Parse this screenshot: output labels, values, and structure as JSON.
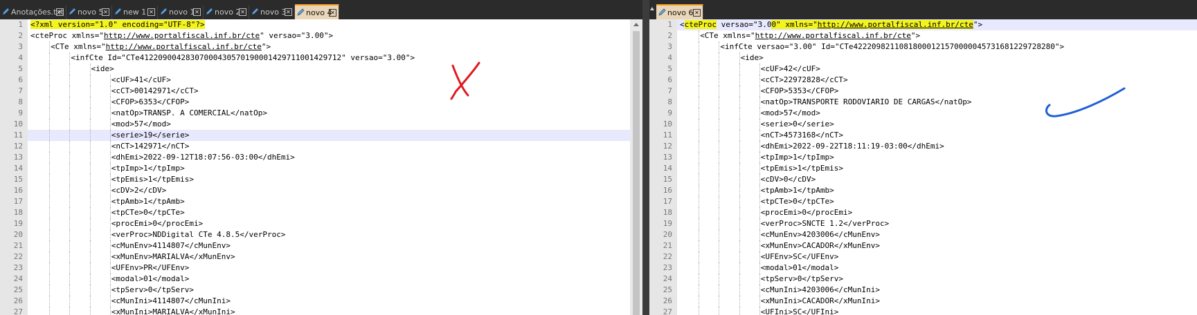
{
  "left": {
    "tabs": [
      {
        "label": "Anotações.txt",
        "active": false
      },
      {
        "label": "novo 5",
        "active": false
      },
      {
        "label": "new 1",
        "active": false
      },
      {
        "label": "novo 1",
        "active": false
      },
      {
        "label": "novo 2",
        "active": false
      },
      {
        "label": "novo 3",
        "active": false
      },
      {
        "label": "novo 4",
        "active": true
      }
    ],
    "line_numbers": [
      "1",
      "2",
      "3",
      "4",
      "5",
      "6",
      "7",
      "8",
      "9",
      "10",
      "11",
      "12",
      "13",
      "14",
      "15",
      "16",
      "17",
      "18",
      "19",
      "20",
      "21",
      "22",
      "23",
      "24",
      "25",
      "26",
      "27"
    ],
    "lines": [
      "<?xml version=\"1.0\" encoding=\"UTF-8\"?>",
      "<cteProc xmlns=\"http://www.portalfiscal.inf.br/cte\" versao=\"3.00\">",
      "<CTe xmlns=\"http://www.portalfiscal.inf.br/cte\">",
      "<infCte Id=\"CTe41220900428307000430570190001429711001429712\" versao=\"3.00\">",
      "<ide>",
      "<cUF>41</cUF>",
      "<cCT>00142971</cCT>",
      "<CFOP>6353</CFOP>",
      "<natOp>TRANSP. A COMERCIAL</natOp>",
      "<mod>57</mod>",
      "<serie>19</serie>",
      "<nCT>142971</nCT>",
      "<dhEmi>2022-09-12T18:07:56-03:00</dhEmi>",
      "<tpImp>1</tpImp>",
      "<tpEmis>1</tpEmis>",
      "<cDV>2</cDV>",
      "<tpAmb>1</tpAmb>",
      "<tpCTe>0</tpCTe>",
      "<procEmi>0</procEmi>",
      "<verProc>NDDigital CTe 4.8.5</verProc>",
      "<cMunEnv>4114807</cMunEnv>",
      "<xMunEnv>MARIALVA</xMunEnv>",
      "<UFEnv>PR</UFEnv>",
      "<modal>01</modal>",
      "<tpServ>0</tpServ>",
      "<cMunIni>4114807</cMunIni>",
      "<xMunIni>MARIALVA</xMunIni>"
    ]
  },
  "right": {
    "tabs": [
      {
        "label": "novo 6",
        "active": true
      }
    ],
    "line_numbers": [
      "1",
      "2",
      "3",
      "4",
      "5",
      "6",
      "7",
      "8",
      "9",
      "10",
      "11",
      "12",
      "13",
      "14",
      "15",
      "16",
      "17",
      "18",
      "19",
      "20",
      "21",
      "22",
      "23",
      "24",
      "25",
      "26",
      "27"
    ],
    "lines": [
      "<cteProc versao=\"3.00\" xmlns=\"http://www.portalfiscal.inf.br/cte\">",
      "<CTe xmlns=\"http://www.portalfiscal.inf.br/cte\">",
      "<infCte versao=\"3.00\" Id=\"CTe42220982110818000121570000045731681229728280\">",
      "<ide>",
      "<cUF>42</cUF>",
      "<cCT>22972828</cCT>",
      "<CFOP>5353</CFOP>",
      "<natOp>TRANSPORTE RODOVIARIO DE CARGAS</natOp>",
      "<mod>57</mod>",
      "<serie>0</serie>",
      "<nCT>4573168</nCT>",
      "<dhEmi>2022-09-22T18:11:19-03:00</dhEmi>",
      "<tpImp>1</tpImp>",
      "<tpEmis>1</tpEmis>",
      "<cDV>0</cDV>",
      "<tpAmb>1</tpAmb>",
      "<tpCTe>0</tpCTe>",
      "<procEmi>0</procEmi>",
      "<verProc>SNCTE 1.2</verProc>",
      "<cMunEnv>4203006</cMunEnv>",
      "<xMunEnv>CACADOR</xMunEnv>",
      "<UFEnv>SC</UFEnv>",
      "<modal>01</modal>",
      "<tpServ>0</tpServ>",
      "<cMunIni>4203006</cMunIni>",
      "<xMunIni>CACADOR</xMunIni>",
      "<UFIni>SC</UFIni>"
    ]
  },
  "colors": {
    "tabbar_bg": "#2b2b2b",
    "active_tab_bg": "#ead6b8",
    "active_tab_accent": "#f59a1b",
    "gutter_bg": "#e6e6e6",
    "current_line_bg": "#e8e8ff",
    "yellow_highlight": "#f3f31d",
    "annotation_red": "#e0191e",
    "annotation_blue": "#1f5fd6"
  },
  "annotations": {
    "left_mark": "red-x",
    "right_mark": "blue-check"
  }
}
